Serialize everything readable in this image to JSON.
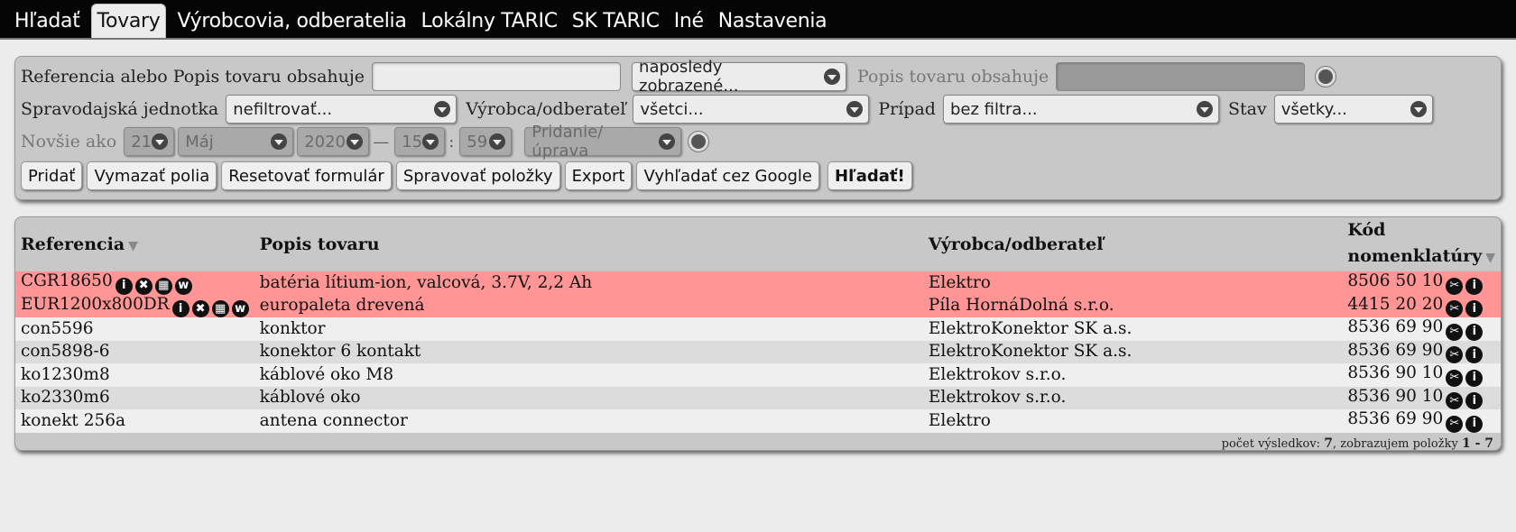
{
  "nav": {
    "tabs": [
      {
        "label": "Hľadať"
      },
      {
        "label": "Tovary"
      },
      {
        "label": "Výrobcovia, odberatelia"
      },
      {
        "label": "Lokálny TARIC"
      },
      {
        "label": "SK TARIC"
      },
      {
        "label": "Iné"
      },
      {
        "label": "Nastavenia"
      }
    ],
    "active_index": 1
  },
  "filters": {
    "ref_label": "Referencia alebo Popis tovaru obsahuje",
    "ref_value": "",
    "order_select": "naposledy zobrazené...",
    "desc_label": "Popis tovaru obsahuje",
    "unit_label": "Spravodajská jednotka",
    "unit_select": "nefiltrovať...",
    "maker_label": "Výrobca/odberateľ",
    "maker_select": "všetci...",
    "case_label": "Prípad",
    "case_select": "bez filtra...",
    "state_label": "Stav",
    "state_select": "všetky...",
    "newer_label": "Novšie ako",
    "day": "21",
    "month": "Máj",
    "year": "2020",
    "dash": "—",
    "hour": "15",
    "colon": ":",
    "minute": "59",
    "change_type": "Pridanie/úprava"
  },
  "buttons": {
    "add": "Pridať",
    "clear": "Vymazať polia",
    "reset": "Resetovať formulár",
    "manage": "Spravovať položky",
    "export": "Export",
    "google": "Vyhľadať cez Google",
    "search": "Hľadať!"
  },
  "table": {
    "headers": {
      "ref": "Referencia",
      "desc": "Popis tovaru",
      "maker": "Výrobca/odberateľ",
      "code_line1": "Kód",
      "code_line2": "nomenklatúry"
    },
    "rows": [
      {
        "ref": "CGR18650",
        "desc": "batéria lítium-ion, valcová, 3.7V, 2,2 Ah",
        "maker": "Elektro",
        "code": "8506 50 10"
      },
      {
        "ref": "EUR1200x800DR",
        "desc": "europaleta drevená",
        "maker": "Píla HornáDolná s.r.o.",
        "code": "4415 20 20"
      },
      {
        "ref": "con5596",
        "desc": "konktor",
        "maker": "ElektroKonektor SK a.s.",
        "code": "8536 69 90"
      },
      {
        "ref": "con5898-6",
        "desc": "konektor 6 kontakt",
        "maker": "ElektroKonektor SK a.s.",
        "code": "8536 69 90"
      },
      {
        "ref": "ko1230m8",
        "desc": "káblové oko M8",
        "maker": "Elektrokov s.r.o.",
        "code": "8536 90 10"
      },
      {
        "ref": "ko2330m6",
        "desc": "káblové oko",
        "maker": "Elektrokov s.r.o.",
        "code": "8536 90 10"
      },
      {
        "ref": "konekt 256a",
        "desc": "antena connector",
        "maker": "Elektro",
        "code": "8536 69 90"
      }
    ],
    "footer": {
      "prefix": "počet výsledkov:",
      "count": "7",
      "mid": ", zobrazujem položky",
      "range": "1 - 7"
    }
  },
  "colors": {
    "highlight_row": "#ff9595",
    "nav_bg": "#050505",
    "panel_bg": "#c8c8c8"
  }
}
